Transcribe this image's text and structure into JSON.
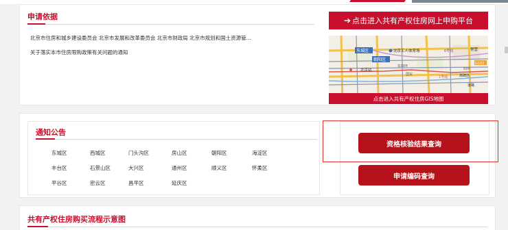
{
  "basis": {
    "title": "申请依据",
    "items": [
      "北京市住房和城乡建设委员会 北京市发展和改革委员会 北京市财政局 北京市规划和国土资源管...",
      "关于落实本市住房限购政策有关问题的通知"
    ]
  },
  "platform": {
    "arrow": "➔",
    "label": "点击进入共有产权住房网上申购平台"
  },
  "map": {
    "caption": "点击进入共有产权住房GIS地图",
    "labels": [
      "东城区",
      "北京工人体育场",
      "朝阳区",
      "北京站",
      "东四环",
      "国贸",
      "6号线",
      "常营",
      "G102",
      "1号线",
      "四环",
      "高碑店",
      "道路"
    ]
  },
  "notice": {
    "title": "通知公告",
    "districts": [
      "东城区",
      "西城区",
      "门头沟区",
      "房山区",
      "朝阳区",
      "海淀区",
      "丰台区",
      "石景山区",
      "大兴区",
      "通州区",
      "顺义区",
      "怀柔区",
      "平谷区",
      "密云区",
      "昌平区",
      "延庆区"
    ]
  },
  "buttons": {
    "qualification": "资格核验结果查询",
    "code_query": "申请编码查询"
  },
  "flow": {
    "title": "共有产权住房购买流程示意图"
  },
  "colors": {
    "brand_red": "#c8102e",
    "button_red": "#b5121b",
    "highlight": "#e0322d"
  }
}
